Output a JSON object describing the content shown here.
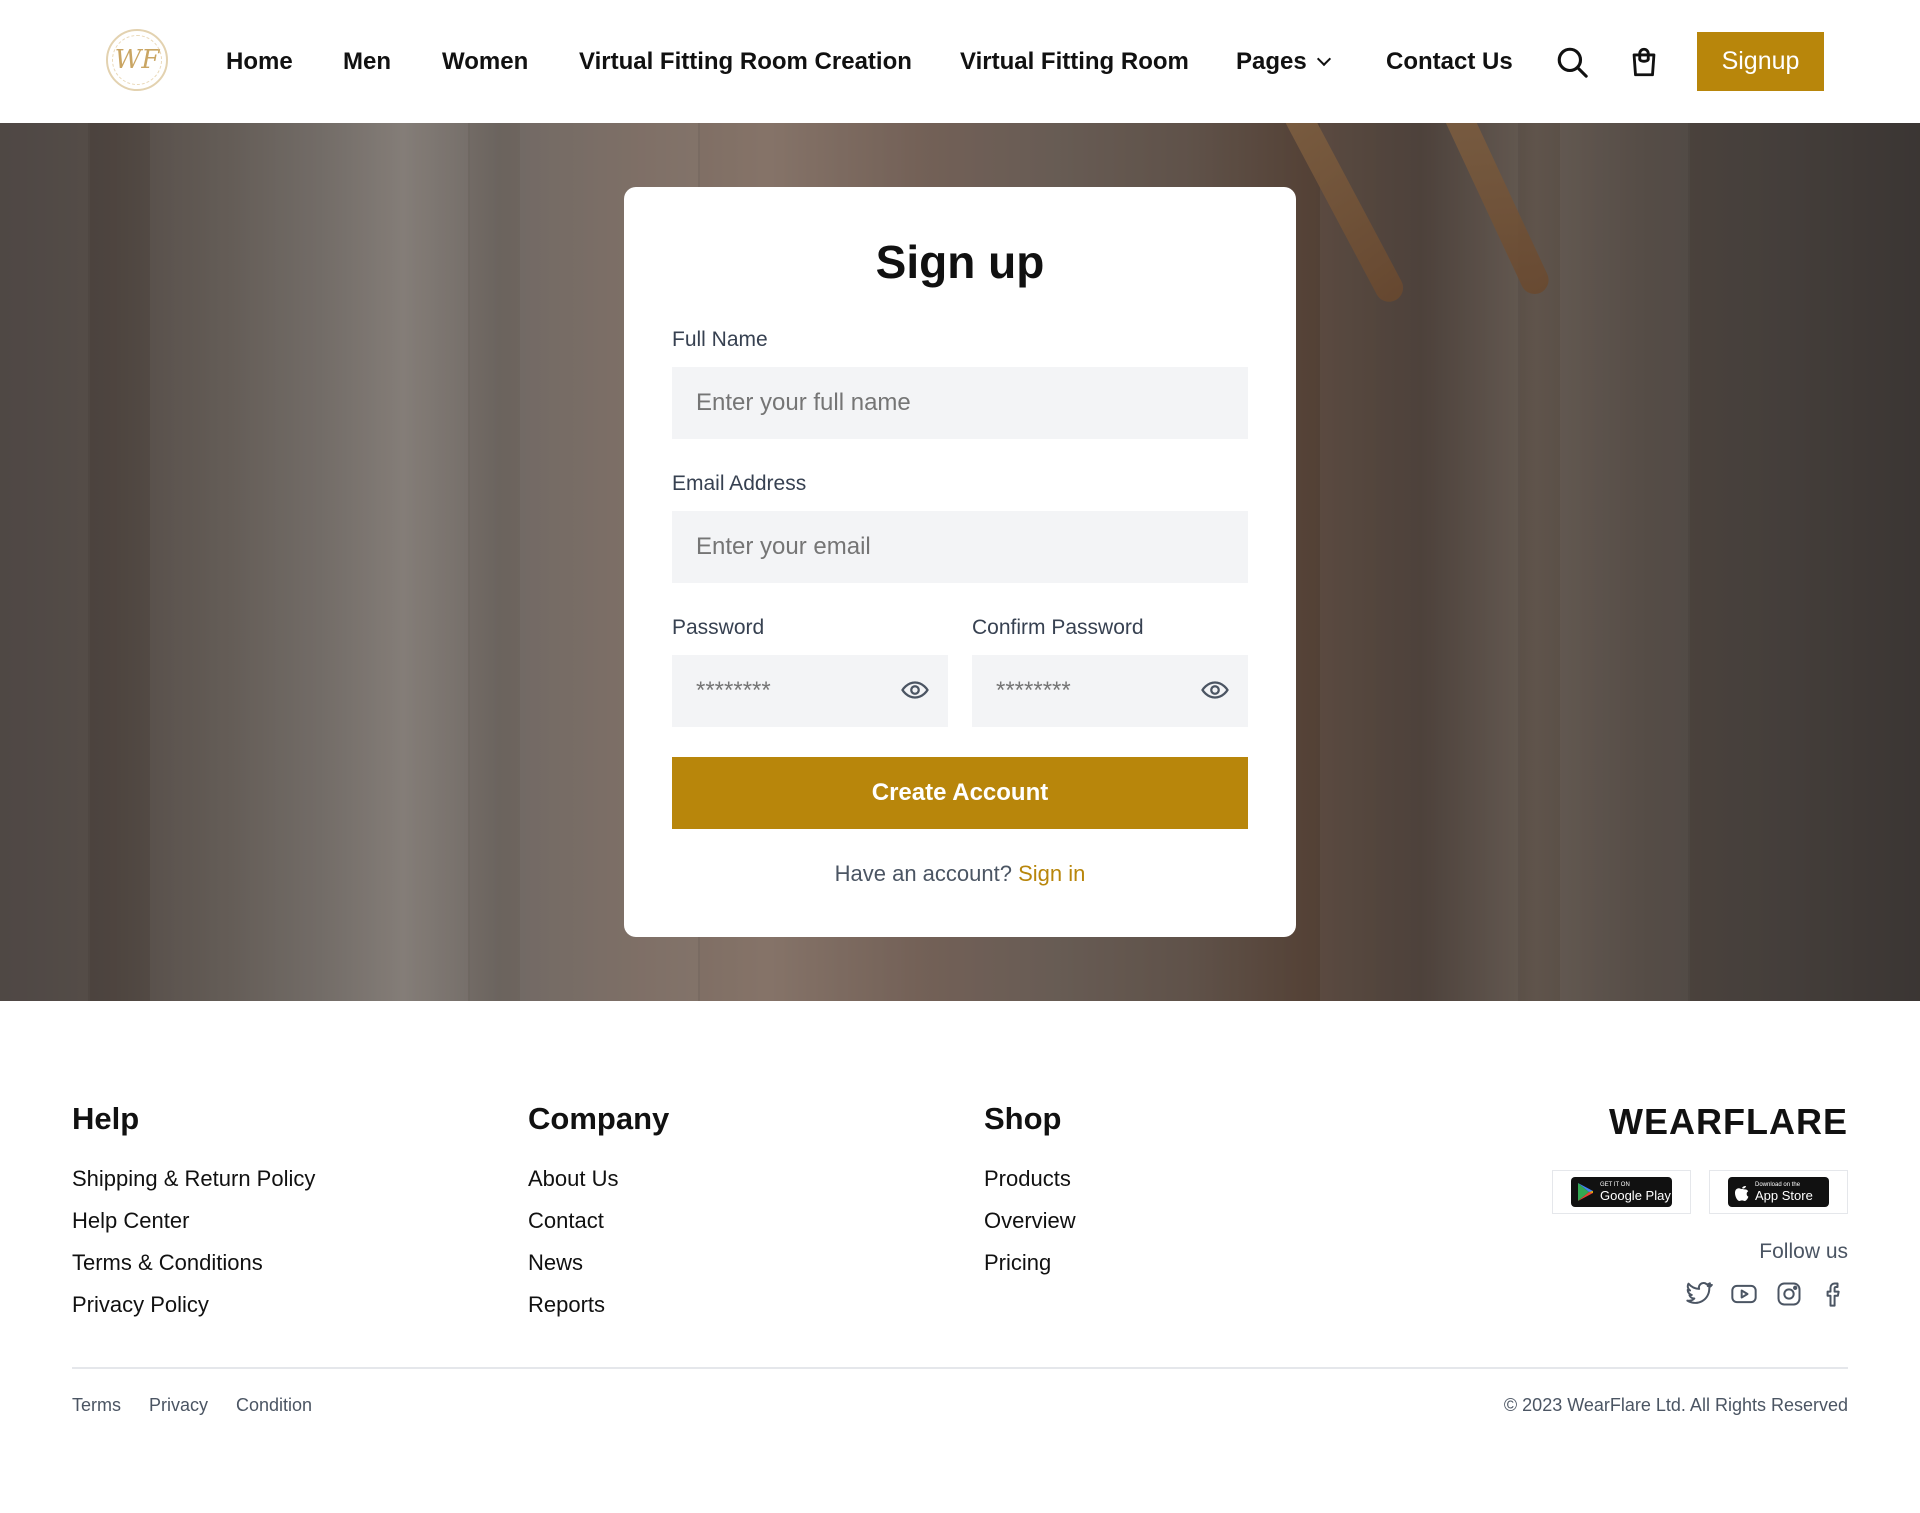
{
  "header": {
    "logo_text": "WF",
    "nav": [
      {
        "label": "Home"
      },
      {
        "label": "Men"
      },
      {
        "label": "Women"
      },
      {
        "label": "Virtual Fitting Room Creation"
      },
      {
        "label": "Virtual Fitting Room"
      },
      {
        "label": "Pages"
      },
      {
        "label": "Contact Us"
      }
    ],
    "icons": {
      "search": "search-icon",
      "cart": "shopping-bag-icon",
      "dropdown": "chevron-down-icon"
    },
    "signup_label": "Signup"
  },
  "signup_form": {
    "title": "Sign up",
    "full_name": {
      "label": "Full Name",
      "placeholder": "Enter your full name",
      "value": ""
    },
    "email": {
      "label": "Email Address",
      "placeholder": "Enter your email",
      "value": ""
    },
    "password": {
      "label": "Password",
      "placeholder": "********",
      "value": ""
    },
    "confirm_password": {
      "label": "Confirm Password",
      "placeholder": "********",
      "value": ""
    },
    "toggle_visibility_icon": "eye-icon",
    "submit_label": "Create Account",
    "have_account_text": "Have an account?",
    "signin_label": "Sign in"
  },
  "footer": {
    "help": {
      "heading": "Help",
      "links": [
        "Shipping & Return Policy",
        "Help Center",
        "Terms & Conditions",
        "Privacy Policy"
      ]
    },
    "company": {
      "heading": "Company",
      "links": [
        "About Us",
        "Contact",
        "News",
        "Reports"
      ]
    },
    "shop": {
      "heading": "Shop",
      "links": [
        "Products",
        "Overview",
        "Pricing"
      ]
    },
    "brand": "WEARFLARE",
    "google_play": {
      "small": "GET IT ON",
      "big": "Google Play"
    },
    "app_store": {
      "small": "Download on the",
      "big": "App Store"
    },
    "follow_label": "Follow us",
    "social_icons": [
      "twitter-icon",
      "youtube-icon",
      "instagram-icon",
      "facebook-icon"
    ],
    "bottom_links": [
      "Terms",
      "Privacy",
      "Condition"
    ],
    "copyright": "© 2023 WearFlare Ltd. All Rights Reserved"
  },
  "colors": {
    "accent": "#b8860b",
    "input_bg": "#f3f4f6",
    "text_muted": "#4b5563"
  }
}
